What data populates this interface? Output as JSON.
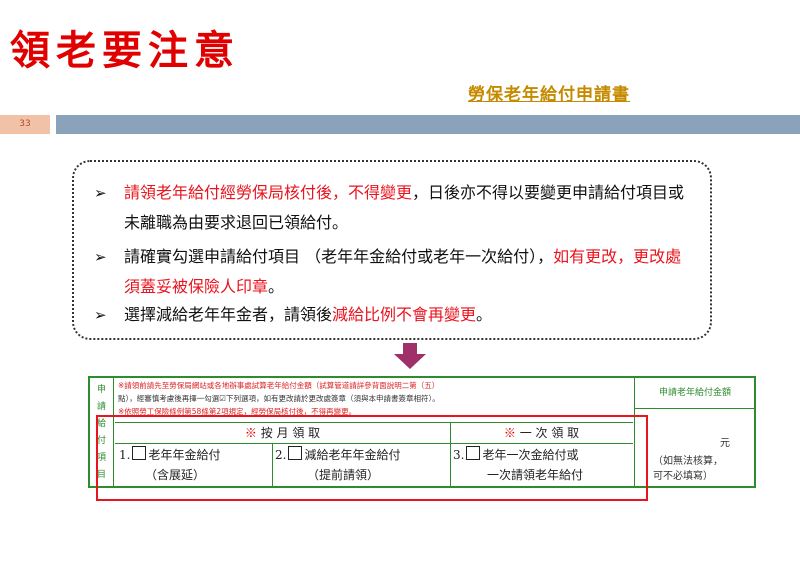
{
  "title": "領老要注意",
  "subtitle": "勞保老年給付申請書",
  "slide_number": "33",
  "callout": {
    "b1_red": "請領老年給付經勞保局核付後，不得變更",
    "b1_rest": "，日後亦不得以要變更申請給付項目或未離職為由要求退回已領給付。",
    "b2_start": "請確實勾選申請給付項目 （老年年金給付或老年一次給付），",
    "b2_red": "如有更改，更改處須蓋妥被保險人印章",
    "b2_end": "。",
    "b3_start": "選擇減給老年年金者，請領後",
    "b3_red": "減給比例不會再變更",
    "b3_end": "。"
  },
  "form": {
    "side_label": "申請給付項目",
    "note_line1": "※請領前請先至勞保局網站或各地辦事處試算老年給付金額（試算管道請詳參背面說明二第（五）",
    "note_line2": "點），經審慎考慮後再擇一勾選☑下列選項，如有更改請於更改處簽章（須與本申請書簽章相符）。",
    "note_line3": "※依照勞工保險條例第58條第2項規定，經勞保局核付後，不得再變更。",
    "right_head": "申請老年給付金額",
    "right_yuan": "元",
    "right_note_1": "（如無法核算，",
    "right_note_2": "可不必填寫）",
    "head_monthly_mark": "※",
    "head_monthly": " 按 月 領 取",
    "head_lump_mark": "※",
    "head_lump": " 一 次 領 取",
    "opt1_num": "1.",
    "opt1_line1": "老年年金給付",
    "opt1_line2": "（含展延）",
    "opt2_num": "2.",
    "opt2_line1": "減給老年年金給付",
    "opt2_line2": "（提前請領）",
    "opt3_num": "3.",
    "opt3_line1": "老年一次金給付或",
    "opt3_line2": "一次請領老年給付"
  },
  "colors": {
    "title_red": "#e00000",
    "subtitle_gold": "#c58a00",
    "highlight_red": "#e8141e",
    "form_green": "#2e8b2e",
    "arrow_purple": "#a0306a",
    "bar_blue": "#8aa3bb"
  }
}
